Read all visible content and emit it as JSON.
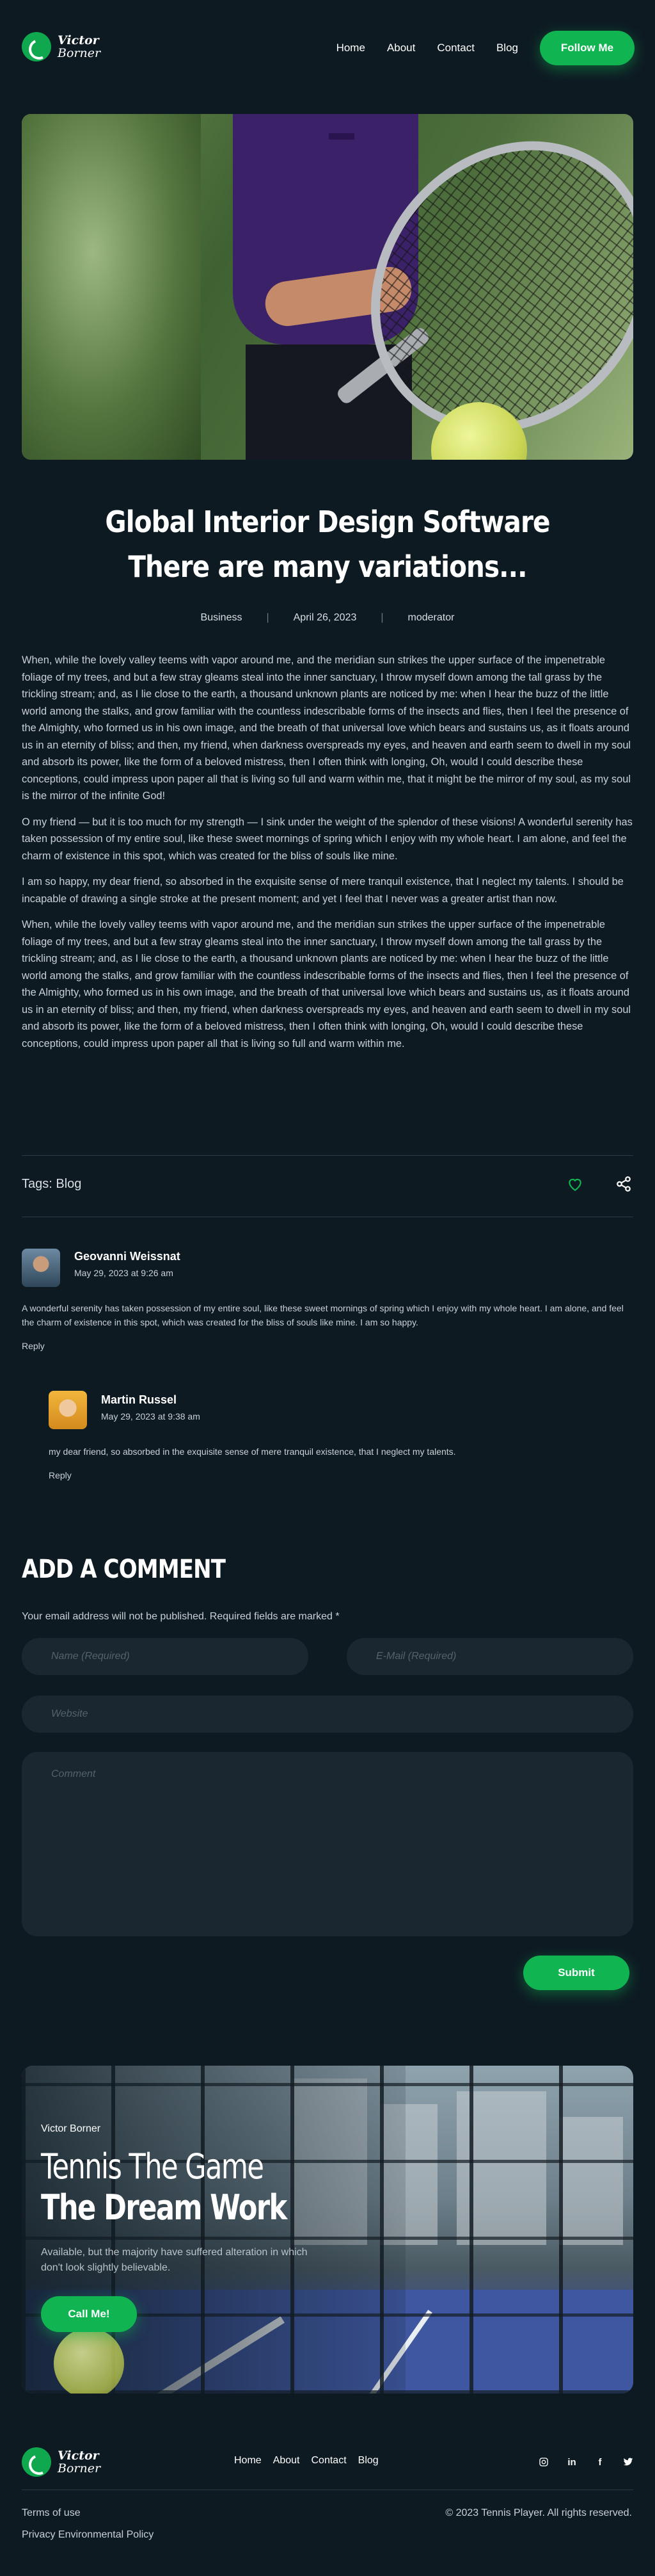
{
  "brand": {
    "line1": "Victor",
    "line2": "Borner"
  },
  "nav": {
    "items": [
      "Home",
      "About",
      "Contact",
      "Blog"
    ],
    "follow_label": "Follow Me"
  },
  "article": {
    "title_line1": "Global Interior Design Software",
    "title_line2": "There are many variations...",
    "category": "Business",
    "date": "April 26, 2023",
    "author": "moderator",
    "paragraphs": [
      "When, while the lovely valley teems with vapor around me, and the meridian sun strikes the upper surface of the impenetrable foliage of my trees, and but a few stray gleams steal into the inner sanctuary, I throw myself down among the tall grass by the trickling stream; and, as I lie close to the earth, a thousand unknown plants are noticed by me: when I hear the buzz of the little world among the stalks, and grow familiar with the countless indescribable forms of the insects and flies, then I feel the presence of the Almighty, who formed us in his own image, and the breath of that universal love which bears and sustains us, as it floats around us in an eternity of bliss; and then, my friend, when darkness overspreads my eyes, and heaven and earth seem to dwell in my soul and absorb its power, like the form of a beloved mistress, then I often think with longing, Oh, would I could describe these conceptions, could impress upon paper all that is living so full and warm within me, that it might be the mirror of my soul, as my soul is the mirror of the infinite God!",
      "O my friend — but it is too much for my strength — I sink under the weight of the splendor of these visions! A wonderful serenity has taken possession of my entire soul, like these sweet mornings of spring which I enjoy with my whole heart. I am alone, and feel the charm of existence in this spot, which was created for the bliss of souls like mine.",
      "I am so happy, my dear friend, so absorbed in the exquisite sense of mere tranquil existence, that I neglect my talents. I should be incapable of drawing a single stroke at the present moment; and yet I feel that I never was a greater artist than now.",
      "When, while the lovely valley teems with vapor around me, and the meridian sun strikes the upper surface of the impenetrable foliage of my trees, and but a few stray gleams steal into the inner sanctuary, I throw myself down among the tall grass by the trickling stream; and, as I lie close to the earth, a thousand unknown plants are noticed by me: when I hear the buzz of the little world among the stalks, and grow familiar with the countless indescribable forms of the insects and flies, then I feel the presence of the Almighty, who formed us in his own image, and the breath of that universal love which bears and sustains us, as it floats around us in an eternity of bliss; and then, my friend, when darkness overspreads my eyes, and heaven and earth seem to dwell in my soul and absorb its power, like the form of a beloved mistress, then I often think with longing, Oh, would I could describe these conceptions, could impress upon paper all that is living so full and warm within me."
    ],
    "tags": "Tags: Blog"
  },
  "comments": [
    {
      "name": "Geovanni Weissnat",
      "date": "May 29, 2023 at 9:26 am",
      "text": "A wonderful serenity has taken possession of my entire soul, like these sweet mornings of spring which I enjoy with my whole heart. I am alone, and feel the charm of existence in this spot, which was created for the bliss of souls like mine. I am so happy.",
      "reply": "Reply"
    },
    {
      "name": "Martin Russel",
      "date": "May 29, 2023 at 9:38 am",
      "text": "my dear friend, so absorbed in the exquisite sense of mere tranquil existence, that I neglect my talents.",
      "reply": "Reply"
    }
  ],
  "form": {
    "heading": "ADD A COMMENT",
    "note": "Your email address will not be published. Required fields are marked *",
    "name_placeholder": "Name (Required)",
    "email_placeholder": "E-Mail (Required)",
    "website_placeholder": "Website",
    "comment_placeholder": "Comment",
    "submit_label": "Submit"
  },
  "banner": {
    "author": "Victor Borner",
    "heading1": "Tennis The Game",
    "heading2": "The Dream Work",
    "description": "Available, but the majority have suffered alteration in which don't look slightly believable.",
    "cta": "Call Me!"
  },
  "footer": {
    "nav": [
      "Home",
      "About",
      "Contact",
      "Blog"
    ],
    "socials": [
      "instagram-icon",
      "linkedin-icon",
      "facebook-icon",
      "twitter-icon"
    ],
    "links": [
      "Terms of use",
      "Privacy Environmental Policy"
    ],
    "copyright": "© 2023 Tennis Player. All rights reserved."
  },
  "colors": {
    "background": "#0e1a22",
    "accent": "#10b552",
    "field": "#1a2630"
  }
}
